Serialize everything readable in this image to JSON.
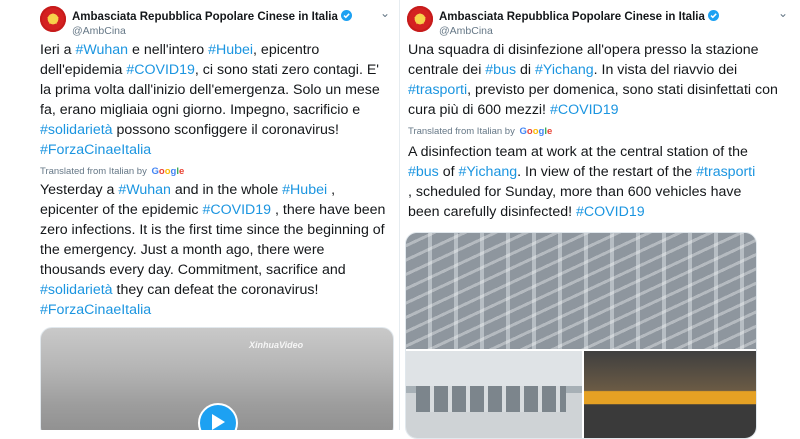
{
  "tweets": [
    {
      "author": "Ambasciata Repubblica Popolare Cinese in Italia",
      "handle": "@AmbCina",
      "original": [
        {
          "t": "Ieri a "
        },
        {
          "h": "#Wuhan"
        },
        {
          "t": " e nell'intero "
        },
        {
          "h": "#Hubei"
        },
        {
          "t": ", epicentro dell'epidemia "
        },
        {
          "h": "#COVID19"
        },
        {
          "t": ", ci sono stati zero contagi. E' la prima volta dall'inizio dell'emergenza. Solo un mese fa, erano migliaia ogni giorno. Impegno, sacrificio e "
        },
        {
          "h": "#solidarietà"
        },
        {
          "t": " possono sconfiggere il coronavirus! "
        },
        {
          "h": "#ForzaCinaeItalia"
        }
      ],
      "translated_label": "Translated from Italian by",
      "translation": [
        {
          "t": "Yesterday a "
        },
        {
          "h": "#Wuhan"
        },
        {
          "t": " and in the whole "
        },
        {
          "h": "#Hubei"
        },
        {
          "t": " , epicenter of the epidemic "
        },
        {
          "h": "#COVID19"
        },
        {
          "t": " , there have been zero infections. It is the first time since the beginning of the emergency. Just a month ago, there were thousands every day. Commitment, sacrifice and "
        },
        {
          "h": "#solidarietà"
        },
        {
          "t": " they can defeat the coronavirus! "
        },
        {
          "h": "#ForzaCinaeItalia"
        }
      ],
      "video_watermark": "XinhuaVideo"
    },
    {
      "author": "Ambasciata Repubblica Popolare Cinese in Italia",
      "handle": "@AmbCina",
      "original": [
        {
          "t": "Una squadra di disinfezione all'opera presso la stazione centrale dei "
        },
        {
          "h": "#bus"
        },
        {
          "t": " di "
        },
        {
          "h": "#Yichang"
        },
        {
          "t": ". In vista del riavvio dei "
        },
        {
          "h": "#trasporti"
        },
        {
          "t": ", previsto per domenica, sono stati disinfettati con cura più di 600 mezzi! "
        },
        {
          "h": "#COVID19"
        }
      ],
      "translated_label": "Translated from Italian by",
      "translation": [
        {
          "t": "A disinfection team at work at the central station of the "
        },
        {
          "h": "#bus"
        },
        {
          "t": " of "
        },
        {
          "h": "#Yichang"
        },
        {
          "t": ". In view of the restart of the "
        },
        {
          "h": "#trasporti"
        },
        {
          "t": " , scheduled for Sunday, more than 600 vehicles have been carefully disinfected! "
        },
        {
          "h": "#COVID19"
        }
      ]
    }
  ],
  "google_logo": [
    "G",
    "o",
    "o",
    "g",
    "l",
    "e"
  ],
  "colors": {
    "link": "#1b95e0",
    "verified": "#1da1f2",
    "text": "#14171a",
    "muted": "#657786"
  },
  "icons": {
    "avatar": "china-emblem-icon",
    "verified": "verified-badge-icon",
    "menu": "chevron-down-icon",
    "play": "play-icon"
  }
}
